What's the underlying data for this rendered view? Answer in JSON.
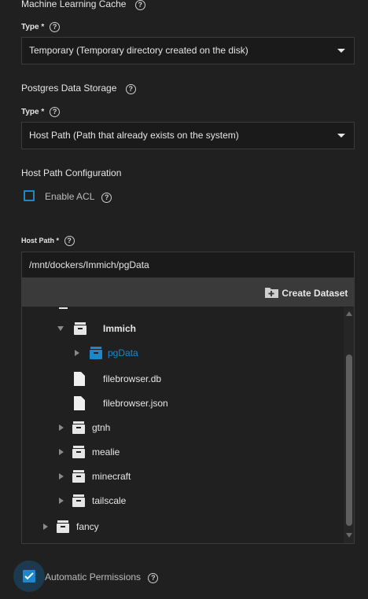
{
  "ml_cache": {
    "title": "Machine Learning Cache",
    "type_label": "Type",
    "required": "*",
    "type_value": "Temporary (Temporary directory created on the disk)"
  },
  "postgres": {
    "title": "Postgres Data Storage",
    "type_label": "Type",
    "required": "*",
    "type_value": "Host Path (Path that already exists on the system)"
  },
  "host_path_config": {
    "title": "Host Path Configuration",
    "enable_acl_label": "Enable ACL",
    "enable_acl_checked": false
  },
  "host_path": {
    "label": "Host Path",
    "required": "*",
    "value": "/mnt/dockers/Immich/pgData",
    "create_dataset_label": "Create Dataset"
  },
  "tree": [
    {
      "name": "Immich",
      "type": "dataset",
      "expanded": true
    },
    {
      "name": "pgData",
      "type": "dataset",
      "selected": true
    },
    {
      "name": "filebrowser.db",
      "type": "file"
    },
    {
      "name": "filebrowser.json",
      "type": "file"
    },
    {
      "name": "gtnh",
      "type": "dataset"
    },
    {
      "name": "mealie",
      "type": "dataset"
    },
    {
      "name": "minecraft",
      "type": "dataset"
    },
    {
      "name": "tailscale",
      "type": "dataset"
    },
    {
      "name": "fancy",
      "type": "dataset"
    }
  ],
  "automatic_permissions": {
    "label": "Automatic Permissions",
    "checked": true
  },
  "colors": {
    "accent": "#1e87c8",
    "background": "#202020",
    "field_bg": "#1a1a1a"
  }
}
